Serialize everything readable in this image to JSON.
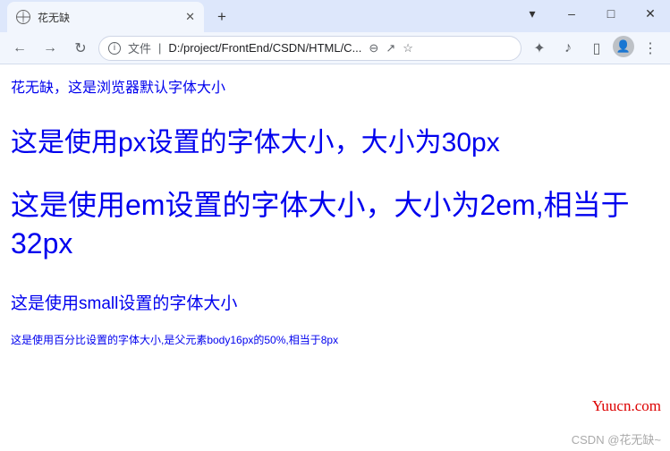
{
  "window": {
    "min_icon": "–",
    "max_icon": "□",
    "restore_icon": "▾",
    "close_icon": "✕"
  },
  "tab": {
    "title": "花无缺",
    "close": "✕",
    "new_tab": "+"
  },
  "toolbar": {
    "back": "←",
    "forward": "→",
    "reload": "↻",
    "file_label": "文件",
    "path": "D:/project/FrontEnd/CSDN/HTML/C...",
    "zoom": "⊖",
    "share": "↗",
    "star": "☆",
    "ext": "✦",
    "music": "♪",
    "reader": "▯",
    "menu": "⋮"
  },
  "content": {
    "line1": "花无缺，这是浏览器默认字体大小",
    "line2": "这是使用px设置的字体大小，大小为30px",
    "line3": "这是使用em设置的字体大小，大小为2em,相当于32px",
    "line4": "这是使用small设置的字体大小",
    "line5": "这是使用百分比设置的字体大小,是父元素body16px的50%,相当于8px"
  },
  "watermark": {
    "w1": "Yuucn.com",
    "w2": "CSDN @花无缺~"
  }
}
